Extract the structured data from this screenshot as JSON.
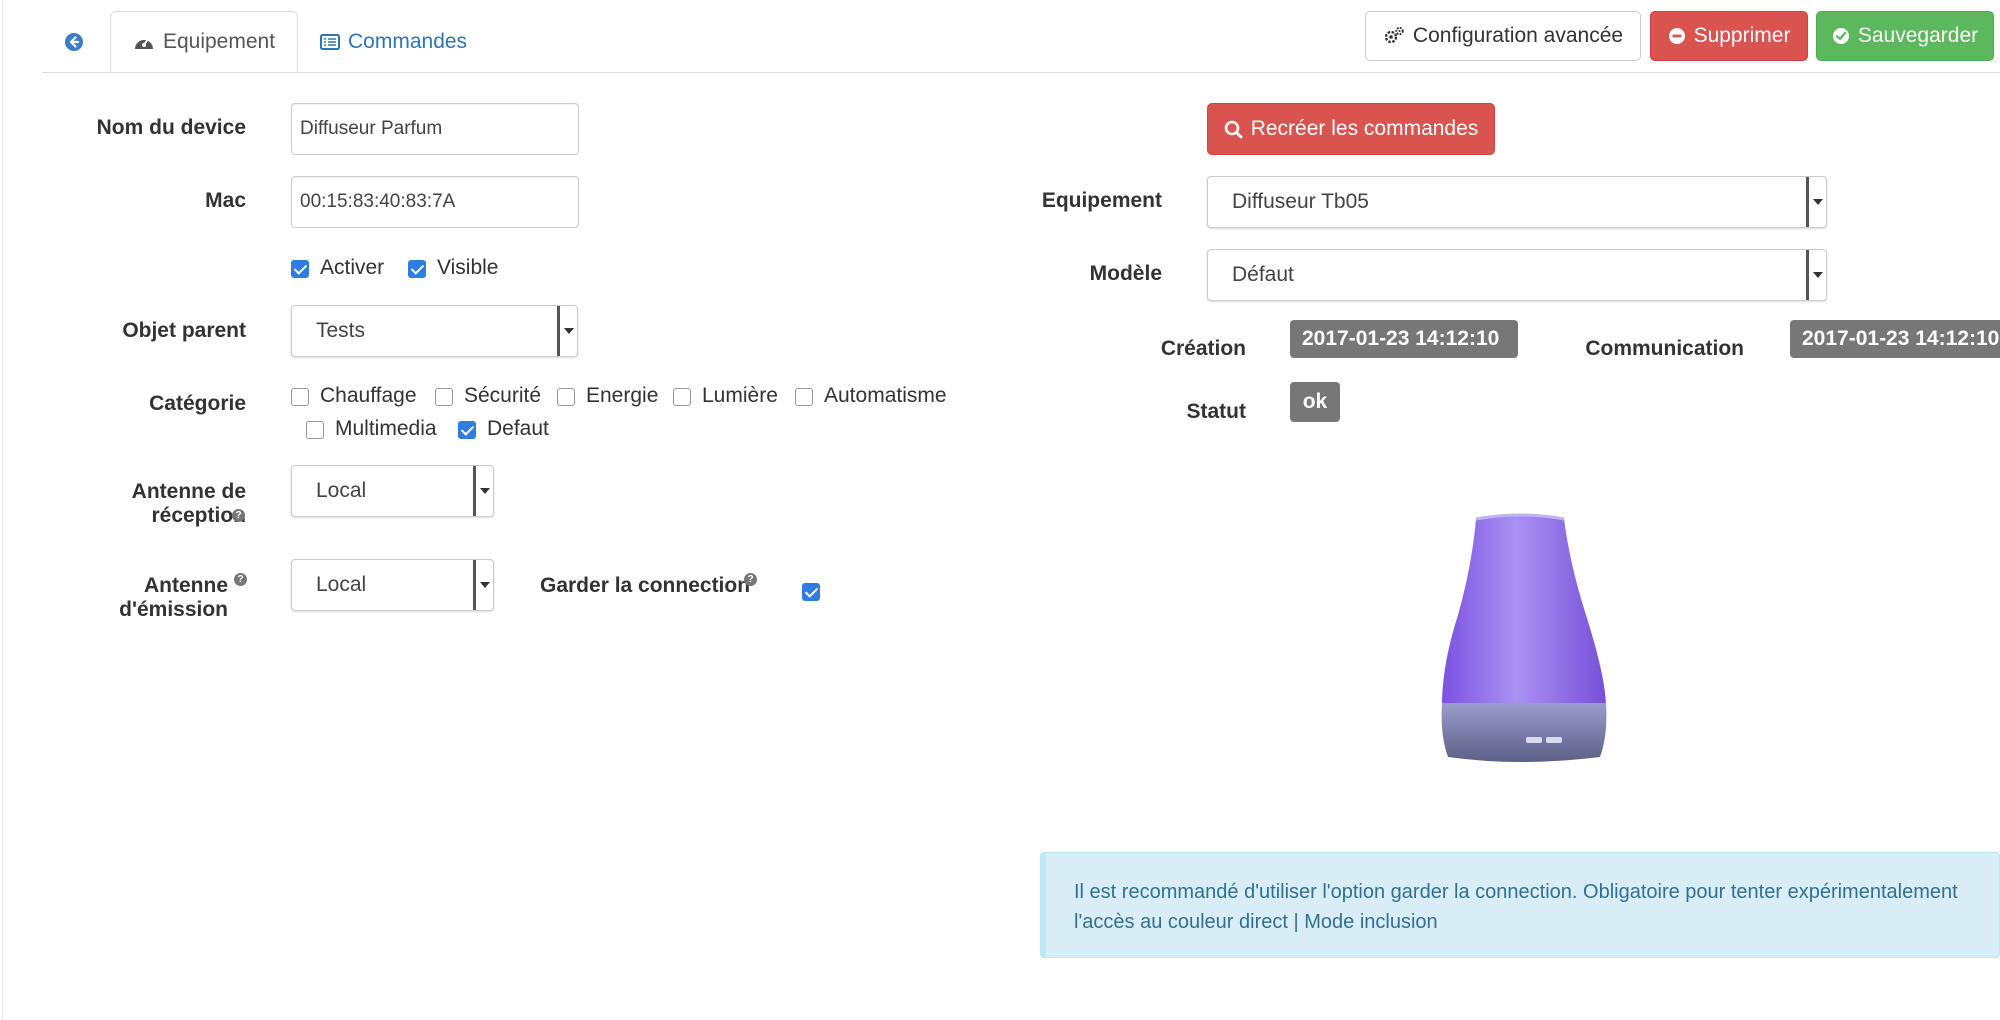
{
  "tabs": {
    "back_label": "",
    "equipement_label": "Equipement",
    "commandes_label": "Commandes"
  },
  "toolbar": {
    "config_label": "Configuration avancée",
    "delete_label": "Supprimer",
    "save_label": "Sauvegarder"
  },
  "form": {
    "name_label": "Nom du device",
    "name_value": "Diffuseur Parfum",
    "mac_label": "Mac",
    "mac_value": "00:15:83:40:83:7A",
    "activer_label": "Activer",
    "visible_label": "Visible",
    "parent_label": "Objet parent",
    "parent_value": "Tests",
    "category_label": "Catégorie",
    "categories": [
      {
        "label": "Chauffage",
        "checked": false
      },
      {
        "label": "Sécurité",
        "checked": false
      },
      {
        "label": "Energie",
        "checked": false
      },
      {
        "label": "Lumière",
        "checked": false
      },
      {
        "label": "Automatisme",
        "checked": false
      },
      {
        "label": "Multimedia",
        "checked": false
      },
      {
        "label": "Defaut",
        "checked": true
      }
    ],
    "antenna_rx_label": "Antenne de réception",
    "antenna_rx_value": "Local",
    "antenna_tx_label": "Antenne d'émission",
    "antenna_tx_value": "Local",
    "keep_conn_label": "Garder la connection"
  },
  "right": {
    "recreate_label": "Recréer les commandes",
    "equipment_label": "Equipement",
    "equipment_value": "Diffuseur Tb05",
    "model_label": "Modèle",
    "model_value": "Défaut",
    "creation_label": "Création",
    "creation_value": "2017-01-23 14:12:10",
    "communication_label": "Communication",
    "communication_value": "2017-01-23 14:12:10",
    "status_label": "Statut",
    "status_value": "ok"
  },
  "alert": {
    "text": "Il est recommandé d'utiliser l'option garder la connection. Obligatoire pour tenter expérimentalement l'accès au couleur direct | Mode inclusion"
  },
  "colors": {
    "primary": "#3a7ec9",
    "danger": "#d9534f",
    "success": "#5cb85c",
    "info_bg": "#d9edf7",
    "info_text": "#31708f",
    "badge": "#777777"
  }
}
